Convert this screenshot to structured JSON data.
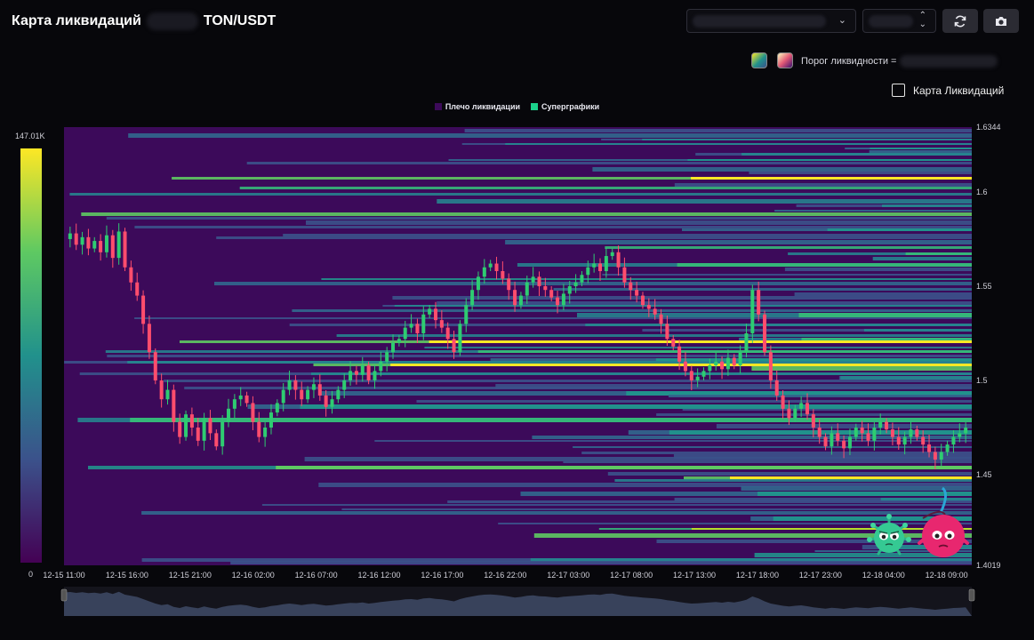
{
  "header": {
    "title_prefix": "Карта ликвидаций",
    "title_pair": "TON/USDT",
    "refresh_icon": "refresh-icon",
    "camera_icon": "camera-icon"
  },
  "controls": {
    "threshold_label": "Порог ликвидности =",
    "checkbox_label": "Карта Ликвидаций",
    "palette_colors": [
      "#21918c",
      "#c0506a"
    ]
  },
  "legend": [
    {
      "label": "Плечо ликвидации",
      "color": "#3c0a5a"
    },
    {
      "label": "Суперграфики",
      "color": "#1bd18b"
    }
  ],
  "colorbar": {
    "max_label": "147.01K",
    "min_label": "0"
  },
  "chart_data": {
    "type": "heatmap",
    "x_ticks": [
      "12-15 11:00",
      "12-15 16:00",
      "12-15 21:00",
      "12-16 02:00",
      "12-16 07:00",
      "12-16 12:00",
      "12-16 17:00",
      "12-16 22:00",
      "12-17 03:00",
      "12-17 08:00",
      "12-17 13:00",
      "12-17 18:00",
      "12-17 23:00",
      "12-18 04:00",
      "12-18 09:00"
    ],
    "y_tick_labels": [
      "1.6344",
      "1.6",
      "1.55",
      "1.5",
      "1.45",
      "1.4019"
    ],
    "y_tick_values": [
      1.6344,
      1.6,
      1.55,
      1.5,
      1.45,
      1.4019
    ],
    "ylim": [
      1.4019,
      1.6344
    ],
    "xlim": [
      0,
      14.4
    ],
    "value_range": [
      0,
      147010
    ],
    "price": [
      1.575,
      1.578,
      1.572,
      1.576,
      1.57,
      1.574,
      1.568,
      1.577,
      1.565,
      1.579,
      1.56,
      1.552,
      1.545,
      1.53,
      1.515,
      1.5,
      1.49,
      1.495,
      1.478,
      1.47,
      1.482,
      1.475,
      1.468,
      1.48,
      1.472,
      1.465,
      1.478,
      1.485,
      1.49,
      1.492,
      1.488,
      1.478,
      1.47,
      1.475,
      1.483,
      1.488,
      1.495,
      1.5,
      1.495,
      1.49,
      1.495,
      1.498,
      1.492,
      1.486,
      1.49,
      1.495,
      1.5,
      1.505,
      1.503,
      1.508,
      1.5,
      1.505,
      1.51,
      1.515,
      1.52,
      1.522,
      1.528,
      1.53,
      1.525,
      1.535,
      1.538,
      1.532,
      1.528,
      1.522,
      1.515,
      1.53,
      1.54,
      1.548,
      1.555,
      1.56,
      1.562,
      1.558,
      1.554,
      1.548,
      1.54,
      1.545,
      1.552,
      1.555,
      1.55,
      1.548,
      1.544,
      1.54,
      1.546,
      1.55,
      1.552,
      1.556,
      1.56,
      1.562,
      1.558,
      1.566,
      1.568,
      1.56,
      1.552,
      1.548,
      1.545,
      1.54,
      1.538,
      1.535,
      1.53,
      1.522,
      1.518,
      1.51,
      1.505,
      1.5,
      1.502,
      1.505,
      1.508,
      1.51,
      1.506,
      1.512,
      1.508,
      1.515,
      1.525,
      1.548,
      1.535,
      1.515,
      1.5,
      1.492,
      1.485,
      1.48,
      1.485,
      1.488,
      1.482,
      1.475,
      1.47,
      1.465,
      1.472,
      1.468,
      1.464,
      1.47,
      1.475,
      1.472,
      1.468,
      1.475,
      1.478,
      1.474,
      1.47,
      1.466,
      1.47,
      1.474,
      1.47,
      1.466,
      1.462,
      1.458,
      1.462,
      1.466,
      1.47,
      1.472,
      1.475
    ]
  },
  "annotations": {
    "mascot_green_icon": "virus-mascot-icon",
    "mascot_pink_icon": "cherry-mascot-icon"
  }
}
